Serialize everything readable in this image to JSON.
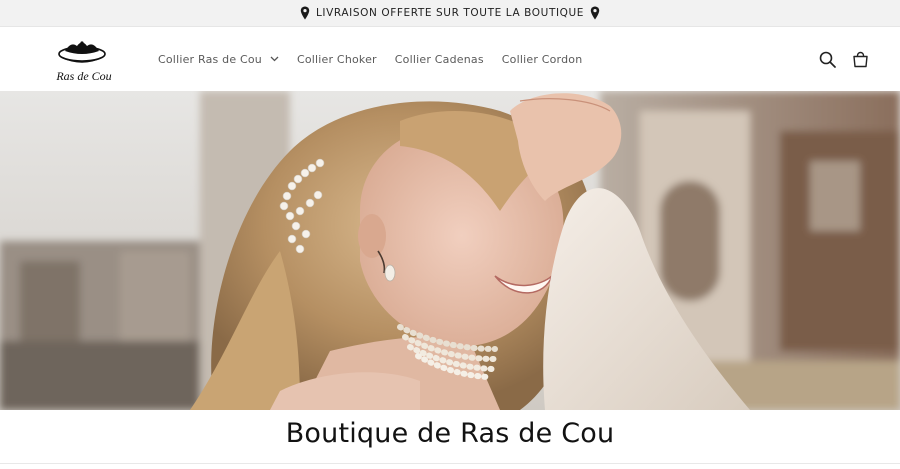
{
  "announcement": {
    "text": "LIVRAISON OFFERTE SUR TOUTE LA BOUTIQUE",
    "icon": "map-pin-icon"
  },
  "header": {
    "logo_text": "Ras de Cou",
    "logo_icon": "choker-necklace-icon",
    "nav": [
      {
        "label": "Collier Ras de Cou",
        "has_dropdown": true
      },
      {
        "label": "Collier Choker",
        "has_dropdown": false
      },
      {
        "label": "Collier Cadenas",
        "has_dropdown": false
      },
      {
        "label": "Collier Cordon",
        "has_dropdown": false
      }
    ],
    "icons": [
      "search-icon",
      "cart-icon"
    ]
  },
  "hero": {
    "image": "smiling blonde woman wearing pearl choker and pearl hair clips"
  },
  "main": {
    "title": "Boutique de Ras de Cou"
  }
}
